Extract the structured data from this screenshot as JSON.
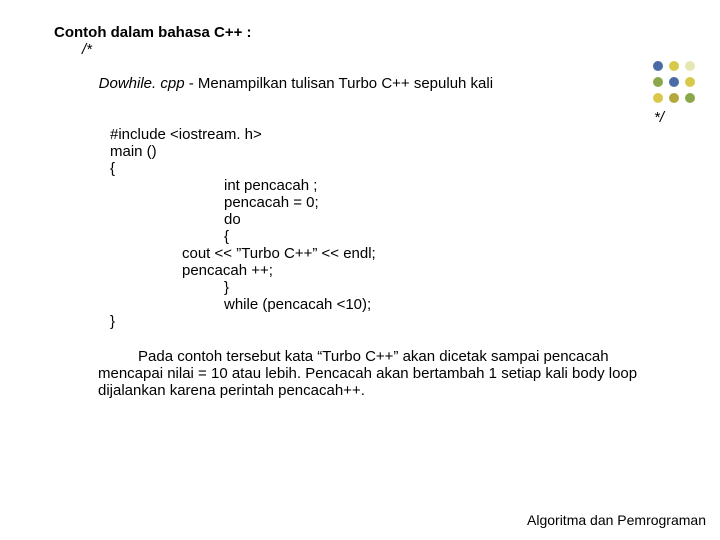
{
  "title_prefix": "Contoh dalam bahasa ",
  "title_lang": "C++",
  "title_suffix": " :",
  "comment_open": "/*",
  "comment_file": "Dowhile. cpp",
  "comment_desc": " - Menampilkan tulisan Turbo C++ sepuluh kali",
  "comment_close": "*/",
  "code": {
    "l1": "#include <iostream. h>",
    "l2": "main ()",
    "l3": "{",
    "l4": "int pencacah ;",
    "l5": "pencacah = 0;",
    "l6": "do",
    "l7": "{",
    "l8": "cout << ”Turbo C++” << endl;",
    "l9": "pencacah ++;",
    "l10": "}",
    "l11": "while (pencacah <10);",
    "l12": "}"
  },
  "para1": "Pada contoh tersebut kata “Turbo C++” akan dicetak sampai                       pencacah mencapai nilai = 10 atau lebih. Pencacah akan  bertambah 1              setiap kali body loop dijalankan karena perintah pencacah++.",
  "footer": "Algoritma dan Pemrograman",
  "dot_colors": {
    "blue": "#4a6aa8",
    "yellow": "#d9c94a",
    "green": "#8aa84a",
    "pale": "#e6e6b2",
    "olive": "#b4a83a"
  }
}
